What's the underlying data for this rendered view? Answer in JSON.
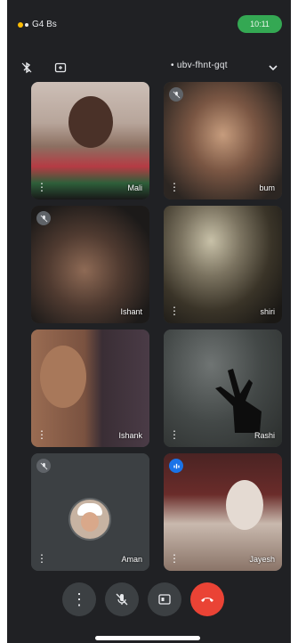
{
  "status_bar": {
    "carrier_text": "G4 Bs",
    "time_pill": "10:11"
  },
  "meeting": {
    "code": "ubv-fhnt-gqt"
  },
  "participants": [
    {
      "name": "Mali"
    },
    {
      "name": "bum"
    },
    {
      "name": "Ishant"
    },
    {
      "name": "shiri"
    },
    {
      "name": "Ishank"
    },
    {
      "name": "Rashi"
    },
    {
      "name": "Aman"
    },
    {
      "name": "Jayesh"
    }
  ],
  "icons": {
    "bluetooth_off": "bluetooth-off-icon",
    "switch_camera": "switch-camera-icon",
    "chevron": "chevron-down-icon",
    "more": "more-vert-icon",
    "mic_off": "mic-off-icon",
    "captions": "captions-icon",
    "end_call": "end-call-icon"
  },
  "colors": {
    "background": "#202124",
    "tile": "#3c4043",
    "end_call": "#ea4335",
    "active_speaker": "#1a73e8",
    "status_pill": "#34a853"
  }
}
